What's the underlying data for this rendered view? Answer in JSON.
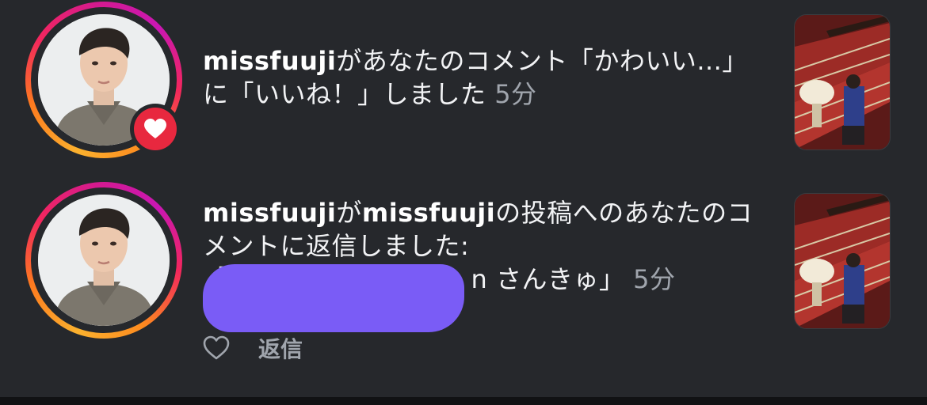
{
  "colors": {
    "background": "#26282c",
    "ring_gradient_start": "#fbb12e",
    "ring_gradient_end": "#c917b3",
    "like_badge": "#e8283f",
    "redaction": "#7a5cf6",
    "secondary_text": "#a0a5ad"
  },
  "notifications": [
    {
      "username": "missfuuji",
      "text": "があなたのコメント「かわいい...」に「いいね！」しました",
      "time": "5分",
      "badge_icon": "heart-icon"
    },
    {
      "username": "missfuuji",
      "text_part1": "が",
      "username2": "missfuuji",
      "text_part2": "の投稿へのあなたのコメントに返信しました:",
      "quote_open": "「",
      "quote_tail": "n さんきゅ」",
      "time": "5分",
      "actions": {
        "like_icon": "heart-outline-icon",
        "reply_label": "返信"
      }
    }
  ]
}
